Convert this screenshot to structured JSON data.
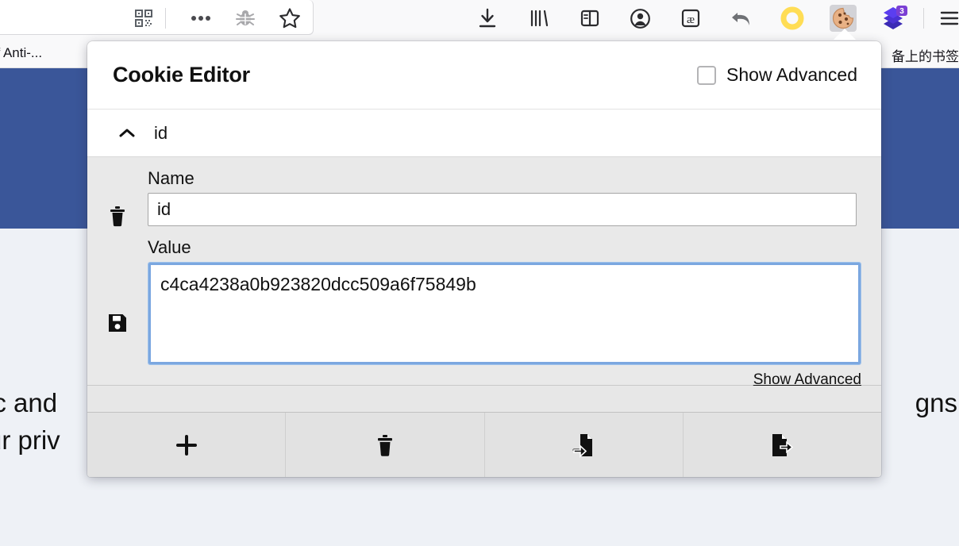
{
  "browser": {
    "toolbar_icons": [
      {
        "name": "qr-code-icon",
        "label": "QR Code"
      },
      {
        "name": "more-options-icon",
        "label": "More"
      },
      {
        "name": "bug-icon",
        "label": "Debug"
      },
      {
        "name": "bookmark-star-icon",
        "label": "Bookmark"
      },
      {
        "name": "download-icon",
        "label": "Downloads"
      },
      {
        "name": "library-icon",
        "label": "Library"
      },
      {
        "name": "sidebar-icon",
        "label": "Sidebar"
      },
      {
        "name": "account-icon",
        "label": "Account"
      },
      {
        "name": "ae-ligature-icon",
        "label": "Dictionary"
      },
      {
        "name": "undo-arrow-icon",
        "label": "Undo"
      },
      {
        "name": "yellow-ring-icon",
        "label": "Ring"
      },
      {
        "name": "cookie-icon",
        "label": "Cookie Editor"
      },
      {
        "name": "purple-layers-icon",
        "label": "Extension"
      },
      {
        "name": "hamburger-menu-icon",
        "label": "Menu"
      }
    ],
    "extension_badge_count": "3",
    "bookmark_left_label": "of Anti-...",
    "bookmark_right_label": "备上的书签"
  },
  "page": {
    "banner_color": "#3a5699",
    "text_left_line1": "ic and",
    "text_left_line2": "ur priv",
    "text_right": "gns"
  },
  "popup": {
    "title": "Cookie Editor",
    "show_advanced_checkbox_label": "Show Advanced",
    "show_advanced_checked": false,
    "cookie": {
      "header_label": "id",
      "collapse_icon": "chevron-up-icon",
      "name_label": "Name",
      "name_value": "id",
      "value_label": "Value",
      "value_value": "c4ca4238a0b923820dcc509a6f75849b",
      "show_advanced_link": "Show Advanced",
      "delete_icon": "trash-icon",
      "save_icon": "floppy-disk-save-icon"
    },
    "footer_buttons": [
      {
        "name": "add-cookie-button",
        "icon": "plus-icon",
        "label": "Add"
      },
      {
        "name": "delete-all-cookies-button",
        "icon": "trash-icon",
        "label": "Delete All"
      },
      {
        "name": "import-cookies-button",
        "icon": "import-file-icon",
        "label": "Import"
      },
      {
        "name": "export-cookies-button",
        "icon": "export-file-icon",
        "label": "Export"
      }
    ],
    "accent_focus_color": "#7ba7e0",
    "header_bg": "#ffffff",
    "body_bg": "#e9e9e9"
  }
}
